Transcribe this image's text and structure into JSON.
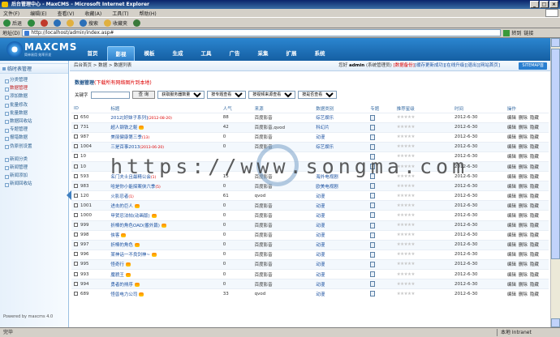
{
  "window": {
    "title": "后台管理中心 - MaxCMS - Microsoft Internet Explorer"
  },
  "menubar": [
    "文件(F)",
    "编辑(E)",
    "查看(V)",
    "收藏(A)",
    "工具(T)",
    "帮助(H)"
  ],
  "toolbar": [
    {
      "label": "后退",
      "color": "#2d8a3e"
    },
    {
      "label": "",
      "color": "#2d8a3e"
    },
    {
      "label": "",
      "color": "#c0392b"
    },
    {
      "label": "",
      "color": "#2a6fb8"
    },
    {
      "label": "",
      "color": "#e0b040"
    },
    {
      "label": "搜索",
      "color": "#2a6fb8"
    },
    {
      "label": "收藏夹",
      "color": "#e0b040"
    },
    {
      "label": "",
      "color": "#3a7a3a"
    }
  ],
  "address": {
    "label": "地址(D)",
    "url": "http://localhost/admin/index.asp#",
    "go": "转到",
    "links": "链接"
  },
  "header": {
    "brand": "MAXCMS",
    "tagline": "简单易用  效率开发",
    "nav": [
      "首页",
      "影视",
      "模板",
      "生成",
      "工具",
      "广告",
      "采集",
      "扩展",
      "系统"
    ]
  },
  "breadcrumb": "后台首页 > 数据 > 数据列表",
  "user": {
    "prefix": "您好",
    "name": "admin",
    "role": "(系统管理员)",
    "links": [
      "数据备份",
      "缓存更新成功",
      "在线升级",
      "退出",
      "网站首页"
    ],
    "site_button": "SITEMAP首"
  },
  "sidebar": {
    "group1": "临时表管理",
    "items1": [
      "分类管理",
      "数据管理",
      "添加数据",
      "批量修改",
      "批量数据",
      "数据回收站",
      "专题管理",
      "报错数据",
      "伪原创设置"
    ],
    "group2_items": [
      "新闻分类",
      "新闻管理",
      "新闻添加",
      "新闻回收站"
    ],
    "footer": "Powered by maxcms 4.0",
    "selected": "数据管理"
  },
  "page": {
    "title": "数据管理",
    "title_note": "(下载所有网络图片到本地)"
  },
  "filter": {
    "label": "关键字",
    "button": "查 询",
    "selects": [
      "获取服务器数量",
      "按专题查看",
      "按视频来源查看",
      "按是否查看"
    ]
  },
  "table": {
    "headers": [
      "ID",
      "标题",
      "人气",
      "来源",
      "数据类别",
      "专题",
      "推荐星级",
      "时间",
      "操作"
    ],
    "ops": [
      "编辑",
      "删除",
      "隐藏"
    ],
    "rows": [
      {
        "id": "650",
        "title": "2012[好妹子系列]",
        "hot": "(2012-08-20)",
        "pop": "88",
        "src": "百度影音",
        "cat": "综艺娱乐",
        "time": "2012-6-30",
        "flame": false
      },
      {
        "id": "731",
        "title": "超人钢铁之躯",
        "hot": "",
        "pop": "42",
        "src": "百度影音,qvod",
        "cat": "科幻片",
        "time": "2012-6-30",
        "flame": true
      },
      {
        "id": "987",
        "title": "美丽健康第三季",
        "hot": "(13)",
        "pop": "0",
        "src": "百度影音",
        "cat": "动漫",
        "time": "2012-6-30",
        "flame": false
      },
      {
        "id": "1004",
        "title": "三是百事2013",
        "hot": "(2013-06-20)",
        "pop": "0",
        "src": "百度影音",
        "cat": "综艺娱乐",
        "time": "2012-6-30",
        "flame": false
      },
      {
        "id": "10",
        "title": "",
        "hot": "",
        "pop": "",
        "src": "",
        "cat": "",
        "time": "2012-6-30",
        "flame": false
      },
      {
        "id": "10",
        "title": "",
        "hot": "",
        "pop": "",
        "src": "",
        "cat": "",
        "time": "2012-6-30",
        "flame": false
      },
      {
        "id": "593",
        "title": "名门夫士且最精公会",
        "hot": "(1)",
        "pop": "15",
        "src": "百度影音",
        "cat": "海外电视剧",
        "time": "2012-6-30",
        "flame": false
      },
      {
        "id": "983",
        "title": "哈是你小能探案侠六季",
        "hot": "(5)",
        "pop": "0",
        "src": "百度影音",
        "cat": "欧美电视剧",
        "time": "2012-6-30",
        "flame": false
      },
      {
        "id": "120",
        "title": "火影忍者",
        "hot": "(1)",
        "pop": "61",
        "src": "qvod",
        "cat": "动漫",
        "time": "2012-6-30",
        "flame": false
      },
      {
        "id": "1001",
        "title": "进击的巨人",
        "hot": "",
        "pop": "0",
        "src": "百度影音",
        "cat": "动漫",
        "time": "2012-6-30",
        "flame": true
      },
      {
        "id": "1000",
        "title": "甲贺忍法帖(动画版)",
        "hot": "",
        "pop": "0",
        "src": "百度影音",
        "cat": "动漫",
        "time": "2012-6-30",
        "flame": true
      },
      {
        "id": "999",
        "title": "折棒的角色OAD(番外篇)",
        "hot": "",
        "pop": "0",
        "src": "百度影音",
        "cat": "动漫",
        "time": "2012-6-30",
        "flame": true
      },
      {
        "id": "998",
        "title": "侠客",
        "hot": "",
        "pop": "0",
        "src": "百度影音",
        "cat": "动漫",
        "time": "2012-6-30",
        "flame": true
      },
      {
        "id": "997",
        "title": "折棒的角色",
        "hot": "",
        "pop": "0",
        "src": "百度影音",
        "cat": "动漫",
        "time": "2012-6-30",
        "flame": true
      },
      {
        "id": "996",
        "title": "某神话一不良剑神~",
        "hot": "",
        "pop": "0",
        "src": "百度影音",
        "cat": "动漫",
        "time": "2012-6-30",
        "flame": true
      },
      {
        "id": "995",
        "title": "怪奇行",
        "hot": "",
        "pop": "0",
        "src": "百度影音",
        "cat": "动漫",
        "time": "2012-6-30",
        "flame": true
      },
      {
        "id": "993",
        "title": "魔貌王",
        "hot": "",
        "pop": "0",
        "src": "百度影音",
        "cat": "动漫",
        "time": "2012-6-30",
        "flame": true
      },
      {
        "id": "994",
        "title": "勇者的排序",
        "hot": "",
        "pop": "0",
        "src": "百度影音",
        "cat": "动漫",
        "time": "2012-6-30",
        "flame": true
      },
      {
        "id": "689",
        "title": "怪兽电力公司",
        "hot": "",
        "pop": "33",
        "src": "qvod",
        "cat": "动漫",
        "time": "2012-6-30",
        "flame": true
      }
    ]
  },
  "statusbar": {
    "left": "完毕",
    "zone": "本地 Intranet"
  },
  "watermark": "https://www.songma.com"
}
